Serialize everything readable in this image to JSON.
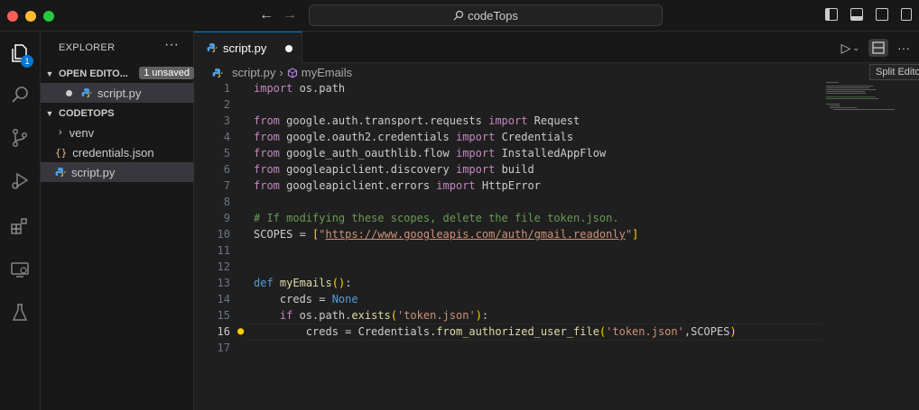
{
  "window": {
    "title": "codeTops"
  },
  "sidebar": {
    "title": "EXPLORER",
    "open_editors_label": "OPEN EDITO...",
    "unsaved_badge": "1 unsaved",
    "open_editor_file": "script.py",
    "folder_label": "CODETOPS",
    "items": [
      {
        "label": "venv",
        "type": "folder"
      },
      {
        "label": "credentials.json",
        "type": "json"
      },
      {
        "label": "script.py",
        "type": "python"
      }
    ]
  },
  "activity": {
    "explorer_badge": "1"
  },
  "editor": {
    "tab_label": "script.py",
    "breadcrumb_file": "script.py",
    "breadcrumb_symbol": "myEmails",
    "tooltip": "Split Editor",
    "current_line": 16
  },
  "code_lines": [
    "import os.path",
    "",
    "from google.auth.transport.requests import Request",
    "from google.oauth2.credentials import Credentials",
    "from google_auth_oauthlib.flow import InstalledAppFlow",
    "from googleapiclient.discovery import build",
    "from googleapiclient.errors import HttpError",
    "",
    "# If modifying these scopes, delete the file token.json.",
    "SCOPES = [\"https://www.googleapis.com/auth/gmail.readonly\"]",
    "",
    "",
    "def myEmails():",
    "    creds = None",
    "    if os.path.exists('token.json'):",
    "        creds = Credentials.from_authorized_user_file('token.json',SCOPES)",
    ""
  ],
  "colors": {
    "accent": "#0078d4",
    "keyword": "#c586c0",
    "comment": "#6a9955",
    "string": "#ce9178",
    "function": "#dcdcaa"
  }
}
